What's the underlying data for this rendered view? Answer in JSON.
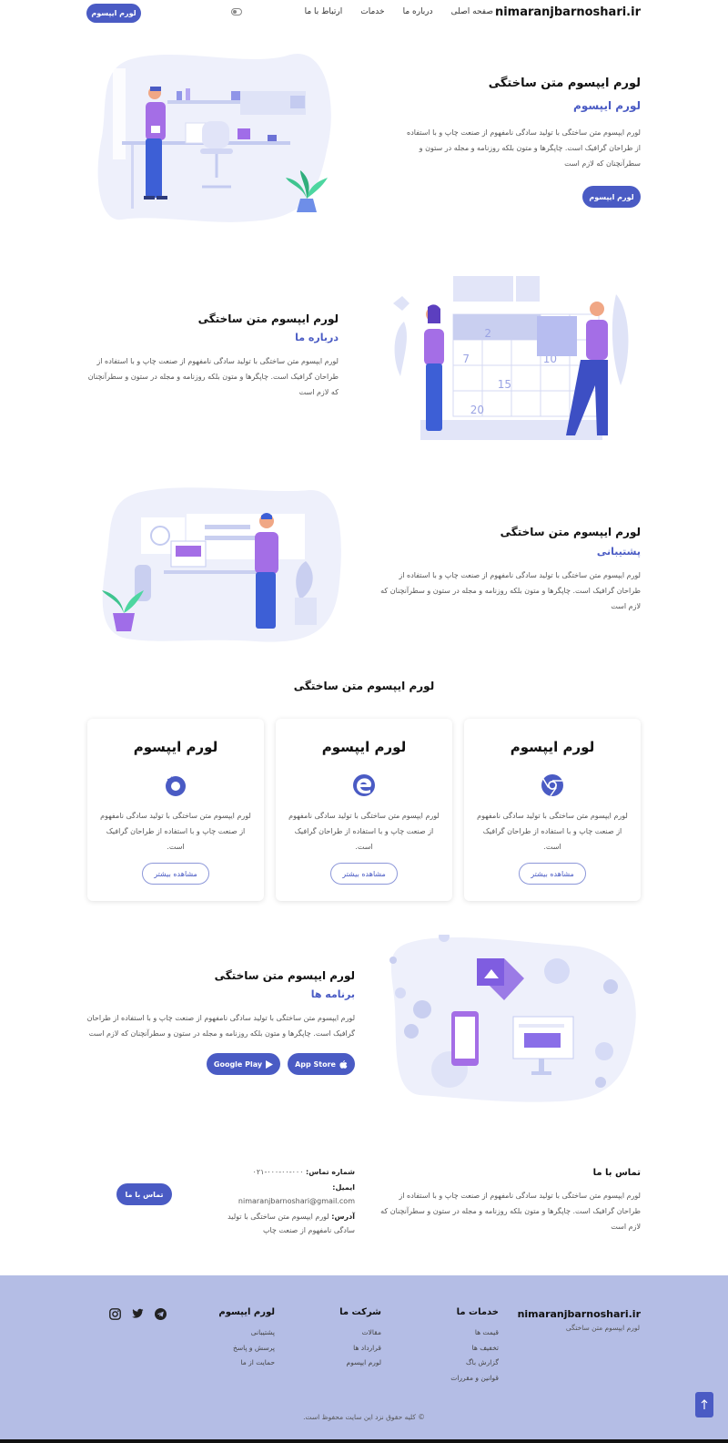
{
  "nav": {
    "brand": "nimaranjbarnoshari.ir",
    "links": [
      "صفحه اصلی",
      "درباره ما",
      "خدمات",
      "ارتباط با ما"
    ],
    "cta": "لورم ایپسوم"
  },
  "hero": {
    "title": "لورم ایپسوم متن ساختگی",
    "subtitle": "لورم ایپسوم",
    "text": "لورم ایپسوم متن ساختگی با تولید سادگی نامفهوم از صنعت چاپ و با استفاده از طراحان گرافیک است. چاپگرها و متون بلکه روزنامه و مجله در ستون و سطرآنچنان که لازم است",
    "button": "لورم ایپسوم"
  },
  "about": {
    "title": "لورم ایپسوم متن ساختگی",
    "subtitle": "درباره ما",
    "text": "لورم ایپسوم متن ساختگی با تولید سادگی نامفهوم از صنعت چاپ و با استفاده از طراحان گرافیک است. چاپگرها و متون بلکه روزنامه و مجله در ستون و سطرآنچنان که لازم است",
    "calendar_numbers": [
      "2",
      "7",
      "10",
      "15",
      "20"
    ]
  },
  "support": {
    "title": "لورم ایپسوم متن ساختگی",
    "subtitle": "پشتیبانی",
    "text": "لورم ایپسوم متن ساختگی با تولید سادگی نامفهوم از صنعت چاپ و با استفاده از طراحان گرافیک است. چاپگرها و متون بلکه روزنامه و مجله در ستون و سطرآنچنان که لازم است"
  },
  "features": {
    "title": "لورم ایپسوم متن ساختگی",
    "cards": [
      {
        "title": "لورم ایپسوم",
        "icon": "chrome-icon",
        "text": "لورم ایپسوم متن ساختگی با تولید سادگی نامفهوم از صنعت چاپ و با استفاده از طراحان گرافیک است.",
        "button": "مشاهده بیشتر"
      },
      {
        "title": "لورم ایپسوم",
        "icon": "edge-icon",
        "text": "لورم ایپسوم متن ساختگی با تولید سادگی نامفهوم از صنعت چاپ و با استفاده از طراحان گرافیک است.",
        "button": "مشاهده بیشتر"
      },
      {
        "title": "لورم ایپسوم",
        "icon": "firefox-icon",
        "text": "لورم ایپسوم متن ساختگی با تولید سادگی نامفهوم از صنعت چاپ و با استفاده از طراحان گرافیک است.",
        "button": "مشاهده بیشتر"
      }
    ]
  },
  "apps": {
    "title": "لورم ایپسوم متن ساختگی",
    "subtitle": "برنامه ها",
    "text": "لورم ایپسوم متن ساختگی با تولید سادگی نامفهوم از صنعت چاپ و با استفاده از طراحان گرافیک است. چاپگرها و متون بلکه روزنامه و مجله در ستون و سطرآنچنان که لازم است",
    "app_store": "App Store",
    "google_play": "Google Play"
  },
  "contact": {
    "title": "تماس با ما",
    "text": "لورم ایپسوم متن ساختگی با تولید سادگی نامفهوم از صنعت چاپ و با استفاده از طراحان گرافیک است. چاپگرها و متون بلکه روزنامه و مجله در ستون و سطرآنچنان که لازم است",
    "phone_label": "شماره تماس:",
    "phone": "۰۰۰-۰۰-۰۰۰-۰۲۱",
    "email_label": "ایمیل:",
    "email": "nimaranjbarnoshari@gmail.com",
    "address_label": "آدرس:",
    "address": "لورم ایپسوم متن ساختگی با تولید سادگی نامفهوم از صنعت چاپ",
    "button": "تماس با ما"
  },
  "footer": {
    "brand": "nimaranjbarnoshari.ir",
    "tagline": "لورم ایپسوم متن ساختگی",
    "columns": [
      {
        "title": "خدمات ما",
        "links": [
          "قیمت ها",
          "تخفیف ها",
          "گزارش باگ",
          "قوانین و مقررات"
        ]
      },
      {
        "title": "شرکت ما",
        "links": [
          "مقالات",
          "قرارداد ها",
          "لورم ایپسوم"
        ]
      },
      {
        "title": "لورم ایپسوم",
        "links": [
          "پشتیبانی",
          "پرسش و پاسخ",
          "حمایت از ما"
        ]
      }
    ],
    "socials": [
      "telegram-icon",
      "twitter-icon",
      "instagram-icon"
    ],
    "copyright": "© کلیه حقوق نزد این سایت محفوظ است."
  },
  "colors": {
    "accent": "#4a5bc4",
    "footer_bg": "#b4bde5",
    "illustration_light": "#eef0fb",
    "illustration_purple": "#9b7be6"
  }
}
